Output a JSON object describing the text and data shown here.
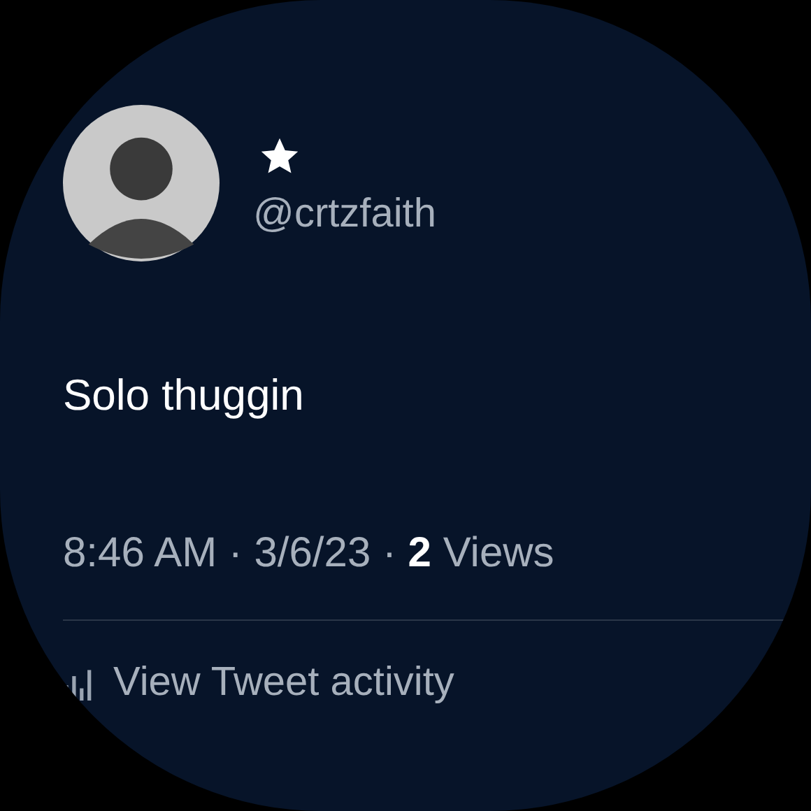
{
  "author": {
    "handle": "@crtzfaith"
  },
  "tweet": {
    "text": "Solo thuggin",
    "meta": "8:46 AM · 3/6/23 · **2** Views"
  },
  "activity_link": "View Tweet activity"
}
